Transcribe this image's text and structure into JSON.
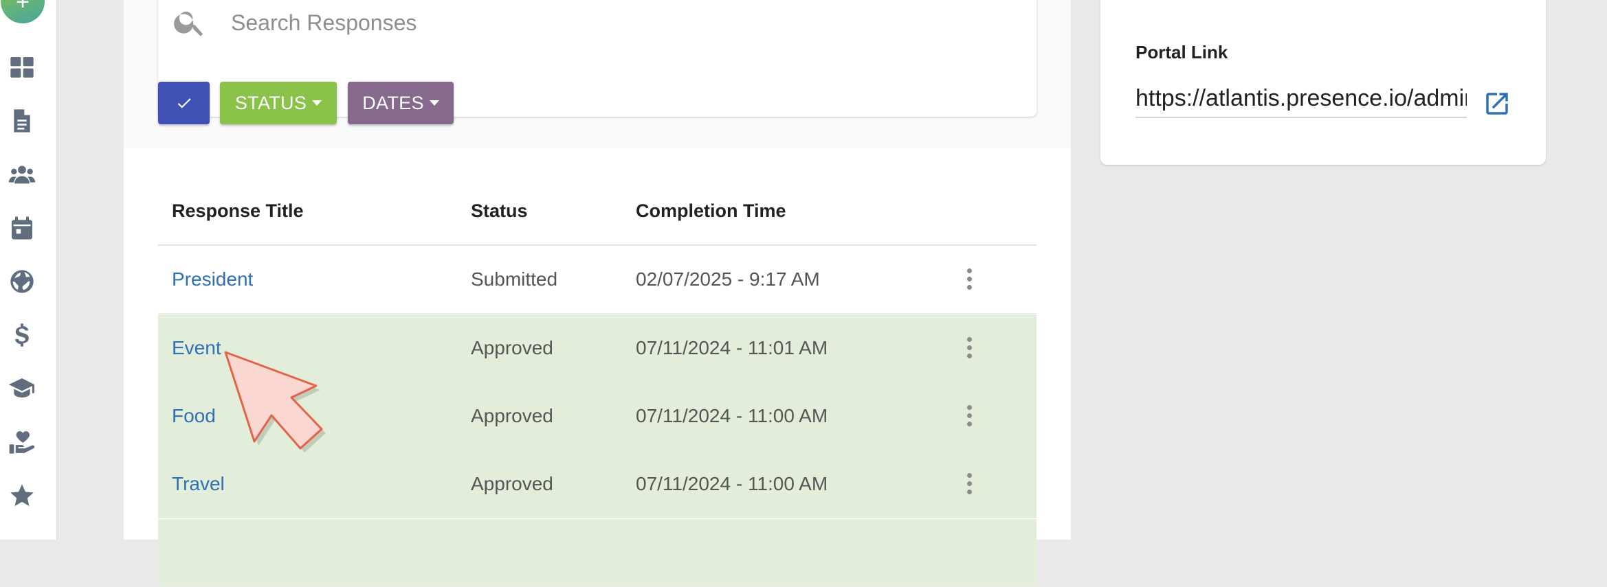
{
  "sidebar": {
    "fab_icon": "plus-icon",
    "items": [
      {
        "icon": "dashboard-icon"
      },
      {
        "icon": "document-icon"
      },
      {
        "icon": "users-icon"
      },
      {
        "icon": "calendar-icon"
      },
      {
        "icon": "globe-icon"
      },
      {
        "icon": "dollar-icon"
      },
      {
        "icon": "graduation-cap-icon"
      },
      {
        "icon": "hand-heart-icon"
      },
      {
        "icon": "star-icon"
      }
    ]
  },
  "search": {
    "placeholder": "Search Responses",
    "value": ""
  },
  "filters": {
    "check_icon": "check-icon",
    "status_label": "STATUS",
    "dates_label": "DATES",
    "colors": {
      "check": "#3f51b5",
      "status": "#8bc34a",
      "dates": "#866a8e"
    }
  },
  "table": {
    "headers": {
      "title": "Response Title",
      "status": "Status",
      "time": "Completion Time"
    },
    "rows": [
      {
        "title": "President",
        "status": "Submitted",
        "time": "02/07/2025 - 9:17 AM"
      },
      {
        "title": "Event",
        "status": "Approved",
        "time": "07/11/2024 - 11:01 AM"
      },
      {
        "title": "Food",
        "status": "Approved",
        "time": "07/11/2024 - 11:00 AM"
      },
      {
        "title": "Travel",
        "status": "Approved",
        "time": "07/11/2024 - 11:00 AM"
      }
    ],
    "approved_row_color": "#e2eed9",
    "link_color": "#2f6fb5"
  },
  "portal": {
    "label": "Portal Link",
    "value": "https://atlantis.presence.io/admin",
    "open_icon": "open-in-new-icon"
  },
  "overlay": {
    "cursor_icon": "pointer-arrow-icon"
  }
}
